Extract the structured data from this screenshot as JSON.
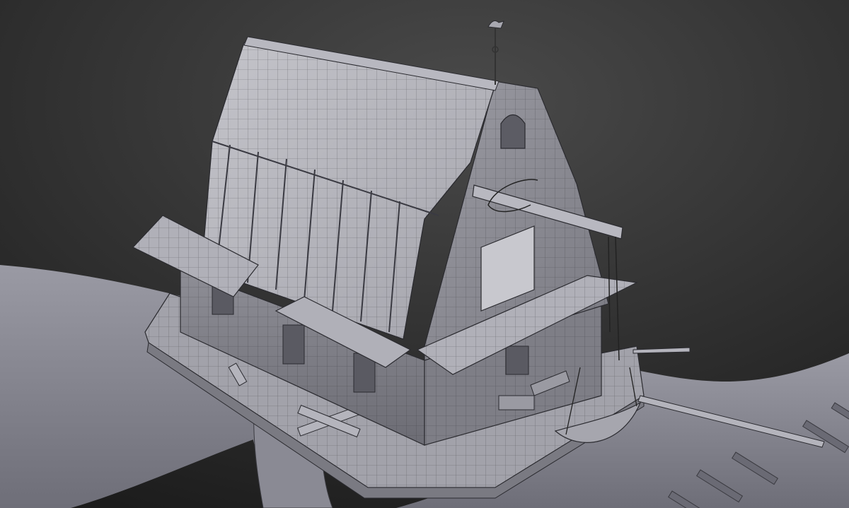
{
  "viewport": {
    "background_top": "#4a4a4a",
    "background_bottom": "#1c1c1c",
    "ground_color": "#8f8f99",
    "wall_color": "#8c8c94",
    "roof_color": "#b2b2b8",
    "deck_color": "#a3a3ab",
    "wire_color": "#2b2b30"
  },
  "scene": {
    "subject": "stilt-house-model",
    "props": [
      "weathervane",
      "crane-beam",
      "rowboat",
      "log-pile",
      "oars"
    ]
  }
}
